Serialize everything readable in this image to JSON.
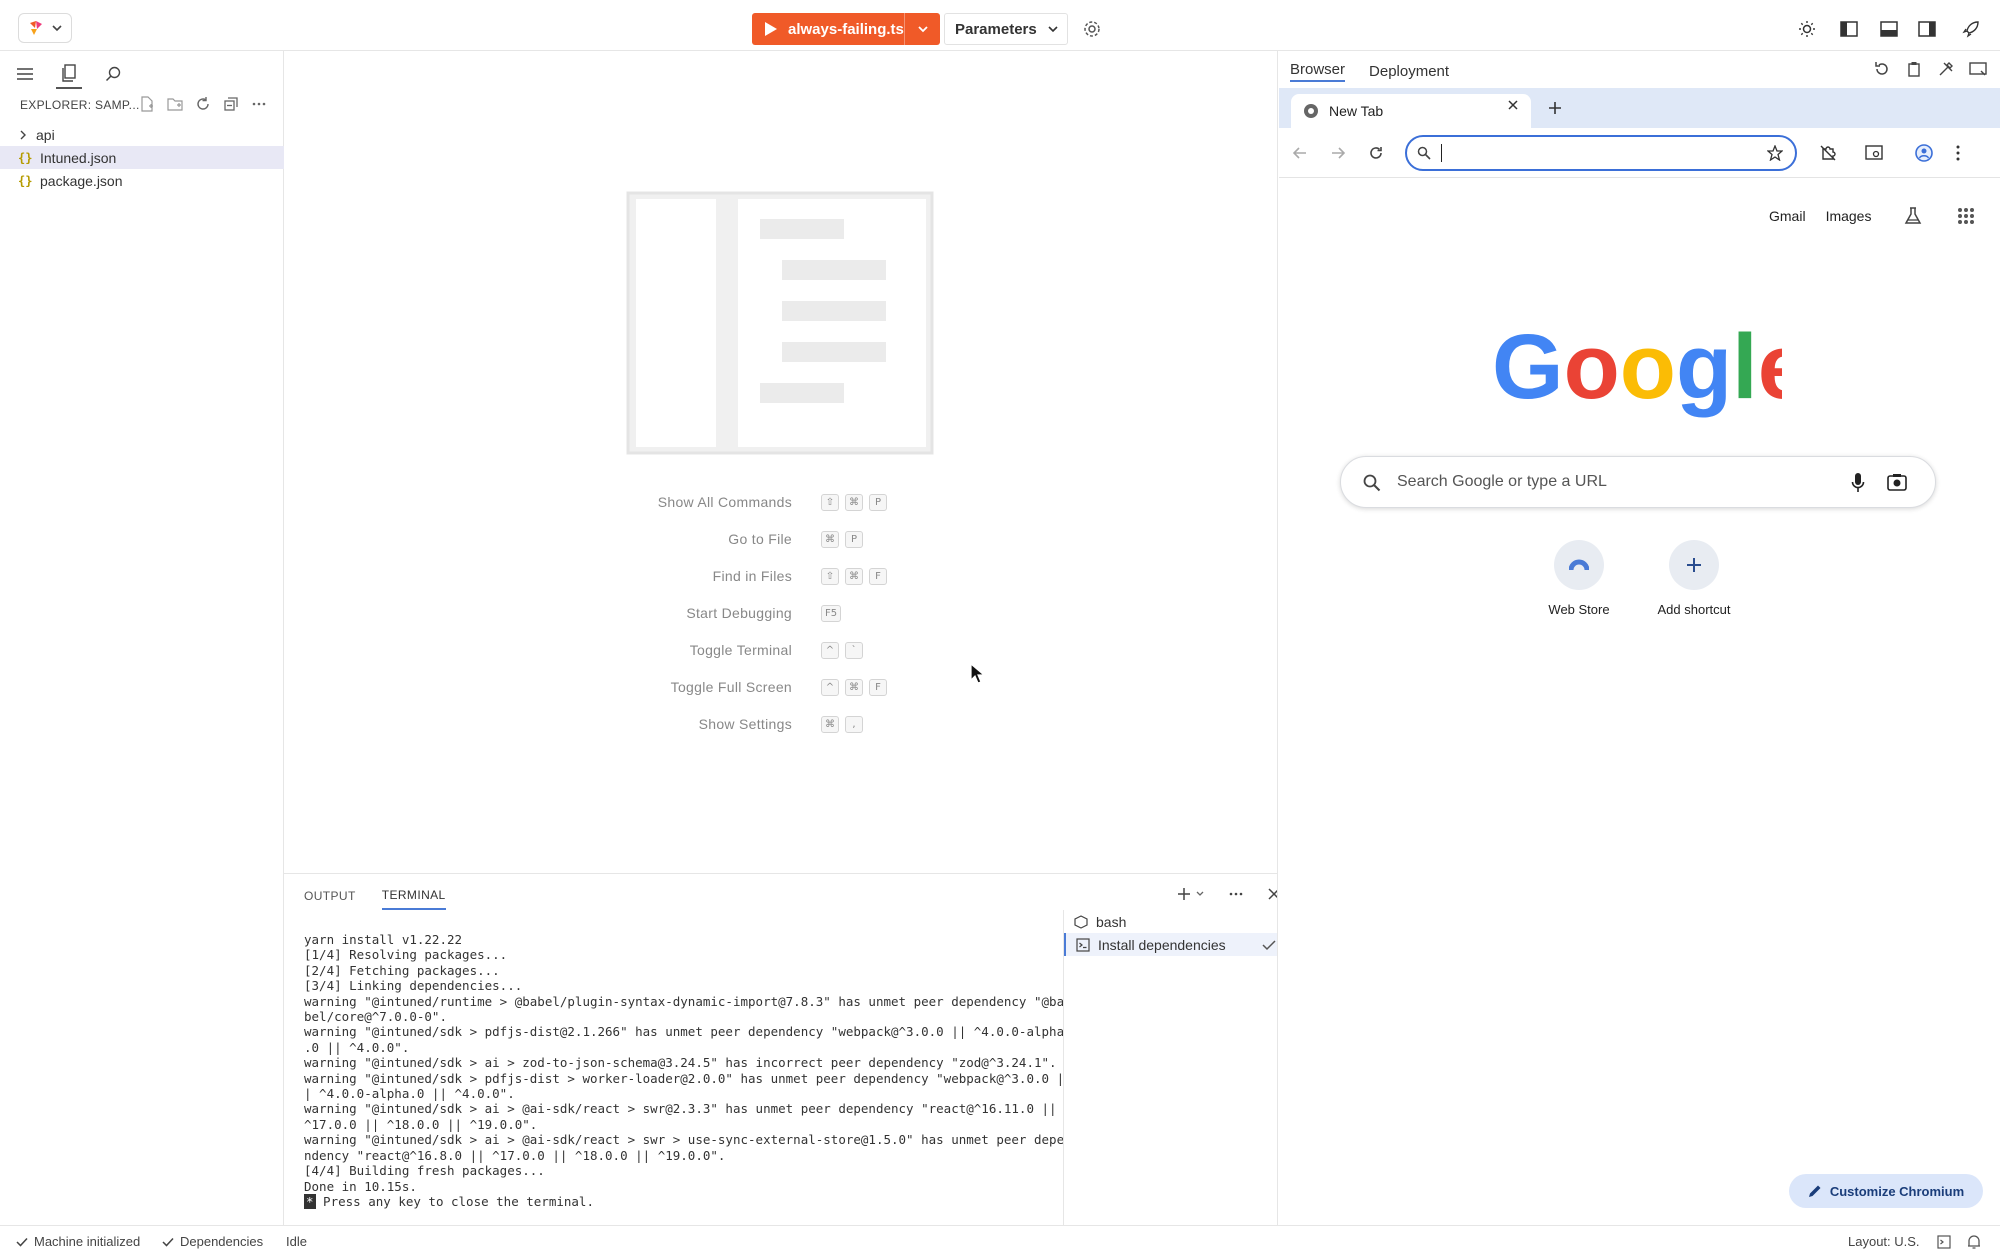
{
  "topbar": {
    "run_file": "always-failing.ts",
    "params_label": "Parameters"
  },
  "sidebar": {
    "explorer_title": "EXPLORER: SAMP...",
    "tree": [
      {
        "name": "api",
        "type": "folder"
      },
      {
        "name": "Intuned.json",
        "type": "json"
      },
      {
        "name": "package.json",
        "type": "json"
      }
    ]
  },
  "editor": {
    "shortcuts": [
      {
        "label": "Show All Commands",
        "keys": [
          "⇧",
          "⌘",
          "P"
        ]
      },
      {
        "label": "Go to File",
        "keys": [
          "⌘",
          "P"
        ]
      },
      {
        "label": "Find in Files",
        "keys": [
          "⇧",
          "⌘",
          "F"
        ]
      },
      {
        "label": "Start Debugging",
        "keys": [
          "F5"
        ]
      },
      {
        "label": "Toggle Terminal",
        "keys": [
          "^",
          "`"
        ]
      },
      {
        "label": "Toggle Full Screen",
        "keys": [
          "^",
          "⌘",
          "F"
        ]
      },
      {
        "label": "Show Settings",
        "keys": [
          "⌘",
          ","
        ]
      }
    ]
  },
  "panel": {
    "tabs": [
      "OUTPUT",
      "TERMINAL"
    ],
    "active_tab": "TERMINAL",
    "terminal_lines": [
      "yarn install v1.22.22",
      "[1/4] Resolving packages...",
      "[2/4] Fetching packages...",
      "[3/4] Linking dependencies...",
      "warning \"@intuned/runtime > @babel/plugin-syntax-dynamic-import@7.8.3\" has unmet peer dependency \"@ba",
      "bel/core@^7.0.0-0\".",
      "warning \"@intuned/sdk > pdfjs-dist@2.1.266\" has unmet peer dependency \"webpack@^3.0.0 || ^4.0.0-alpha",
      ".0 || ^4.0.0\".",
      "warning \"@intuned/sdk > ai > zod-to-json-schema@3.24.5\" has incorrect peer dependency \"zod@^3.24.1\".",
      "warning \"@intuned/sdk > pdfjs-dist > worker-loader@2.0.0\" has unmet peer dependency \"webpack@^3.0.0 |",
      "| ^4.0.0-alpha.0 || ^4.0.0\".",
      "warning \"@intuned/sdk > ai > @ai-sdk/react > swr@2.3.3\" has unmet peer dependency \"react@^16.11.0 ||",
      "^17.0.0 || ^18.0.0 || ^19.0.0\".",
      "warning \"@intuned/sdk > ai > @ai-sdk/react > swr > use-sync-external-store@1.5.0\" has unmet peer depe",
      "ndency \"react@^16.8.0 || ^17.0.0 || ^18.0.0 || ^19.0.0\".",
      "[4/4] Building fresh packages...",
      "Done in 10.15s.",
      " Press any key to close the terminal."
    ],
    "terminals": [
      {
        "name": "bash"
      },
      {
        "name": "Install dependencies"
      }
    ]
  },
  "right": {
    "tabs": [
      "Browser",
      "Deployment"
    ],
    "active_tab": "Browser"
  },
  "browser": {
    "tab_title": "New Tab",
    "omnibox_value": "",
    "links": [
      "Gmail",
      "Images"
    ],
    "search_placeholder": "Search Google or type a URL",
    "shortcuts": [
      "Web Store",
      "Add shortcut"
    ],
    "customize_label": "Customize Chromium"
  },
  "statusbar": {
    "machine": "Machine initialized",
    "deps": "Dependencies",
    "state": "Idle",
    "layout": "Layout: U.S."
  },
  "colors": {
    "accent": "#f05a28",
    "focus_blue": "#3b6fd8"
  }
}
